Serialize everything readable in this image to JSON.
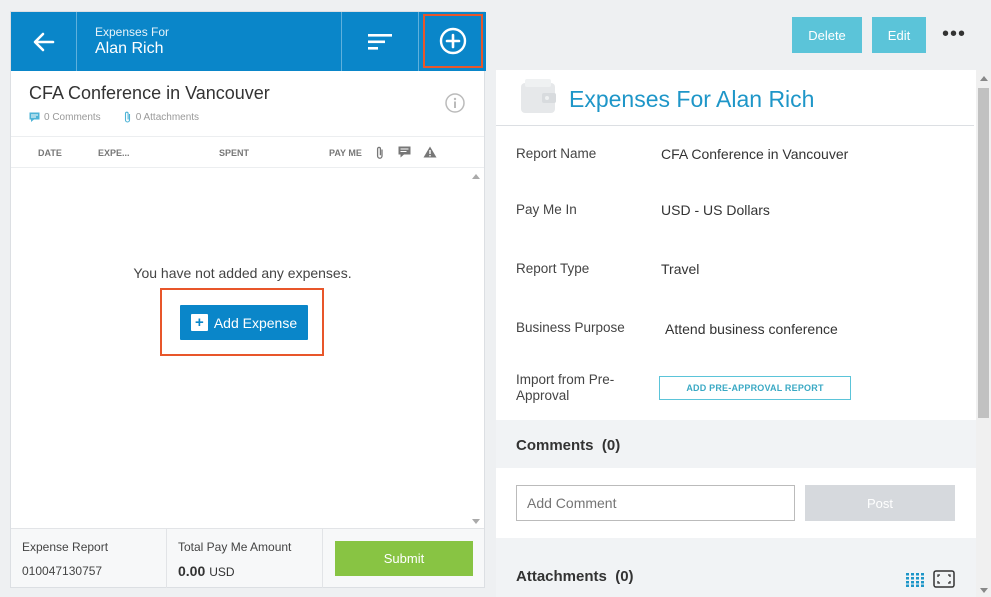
{
  "left_panel": {
    "header": {
      "subtitle": "Expenses For",
      "title": "Alan Rich",
      "back_icon": "arrow-left-icon",
      "sort_icon": "sort-lines-icon",
      "add_icon": "plus-circle-icon"
    },
    "report": {
      "name": "CFA Conference in Vancouver",
      "comments": "0 Comments",
      "attachments": "0 Attachments"
    },
    "columns": {
      "date": "DATE",
      "expense": "EXPE...",
      "spent": "SPENT",
      "pay_me": "PAY ME"
    },
    "empty_message": "You have not added any expenses.",
    "add_expense_label": "Add Expense",
    "footer": {
      "expense_report_label": "Expense Report",
      "expense_report_number": "010047130757",
      "total_label": "Total Pay Me Amount",
      "total_amount": "0.00",
      "total_currency": "USD",
      "submit_label": "Submit"
    }
  },
  "toolbar": {
    "delete_label": "Delete",
    "edit_label": "Edit",
    "more_label": "•••"
  },
  "right_panel": {
    "title": "Expenses For Alan Rich",
    "fields": [
      {
        "label": "Report Name",
        "value": "CFA Conference in Vancouver"
      },
      {
        "label": "Pay Me In",
        "value": "USD - US Dollars"
      },
      {
        "label": "Report Type",
        "value": "Travel"
      },
      {
        "label": "Business Purpose",
        "value": "Attend business conference"
      },
      {
        "label": "Import from Pre-Approval",
        "value": ""
      }
    ],
    "preapproval_button": "ADD PRE-APPROVAL REPORT",
    "comments_title": "Comments",
    "comments_count": "(0)",
    "comment_placeholder": "Add Comment",
    "post_label": "Post",
    "attachments_title": "Attachments",
    "attachments_count": "(0)"
  },
  "colors": {
    "brand_blue": "#0a86c9",
    "accent_teal": "#5bc4d9",
    "submit_green": "#88c443",
    "highlight_orange": "#e8562a"
  }
}
